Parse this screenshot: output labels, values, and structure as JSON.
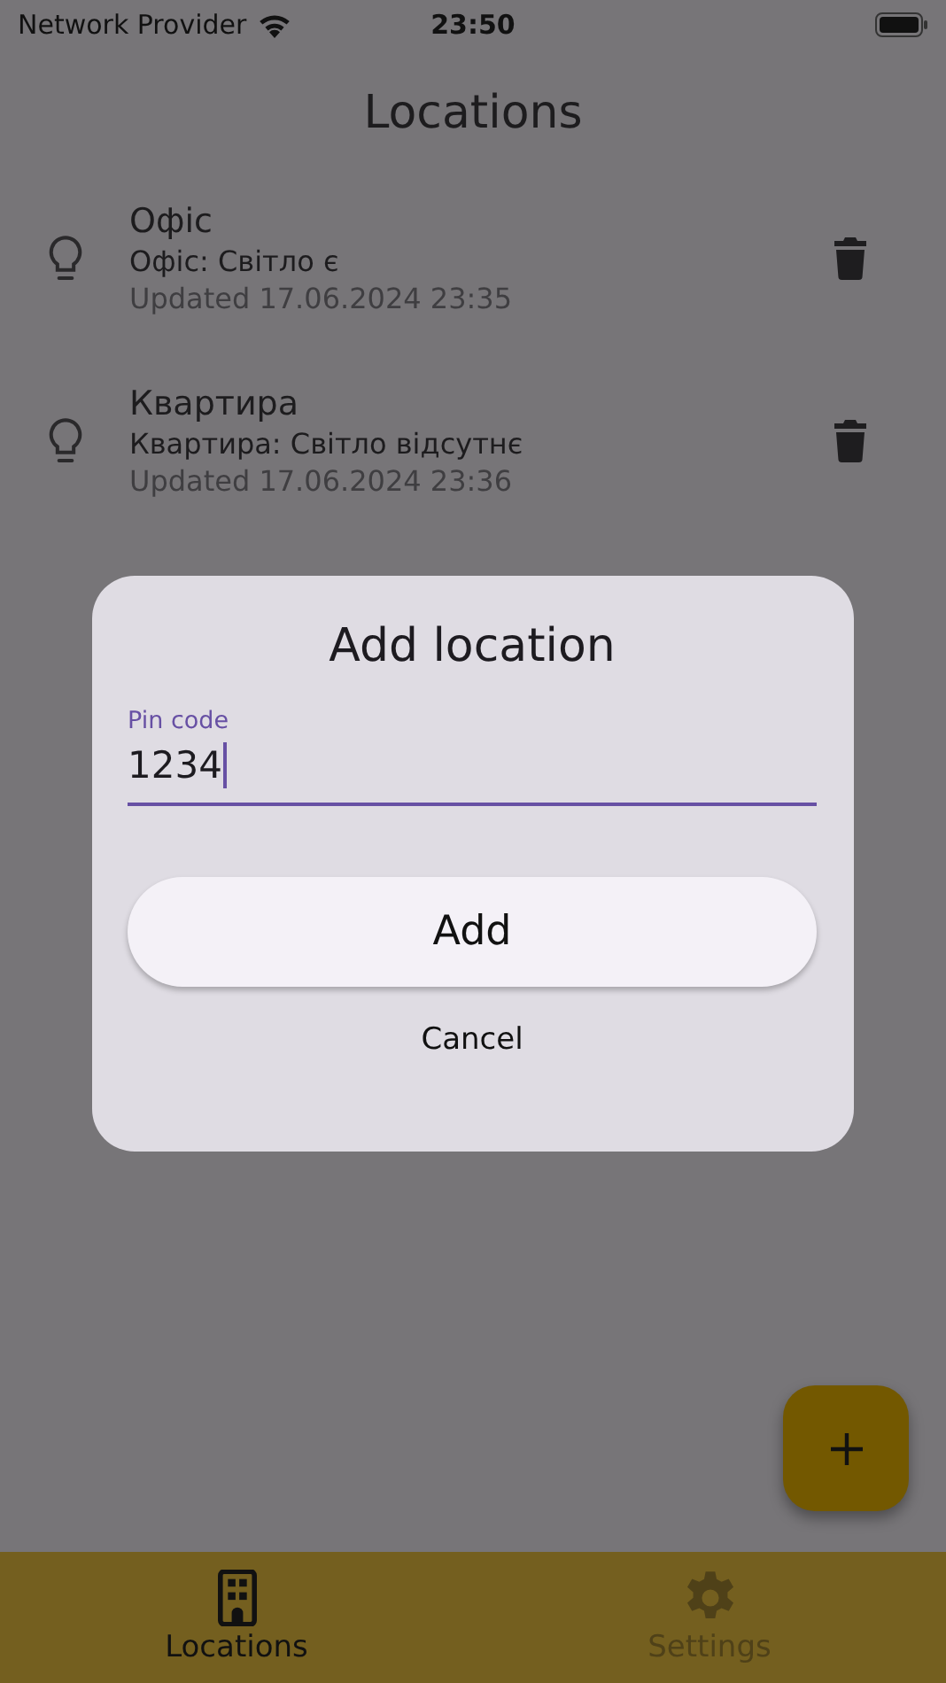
{
  "status_bar": {
    "carrier": "Network Provider",
    "time": "23:50"
  },
  "title": "Locations",
  "locations": [
    {
      "name": "Офіс",
      "status": "Офіс: Світло є",
      "updated": "Updated 17.06.2024 23:35"
    },
    {
      "name": "Квартира",
      "status": "Квартира: Світло відсутнє",
      "updated": "Updated 17.06.2024 23:36"
    }
  ],
  "dialog": {
    "title": "Add location",
    "field": {
      "label": "Pin code",
      "value": "1234",
      "focused": true
    },
    "buttons": [
      {
        "label": "Add",
        "kind": "filled"
      },
      {
        "label": "Cancel",
        "kind": "text"
      }
    ]
  },
  "nav": [
    {
      "label": "Locations",
      "kind": "building",
      "selected": true
    },
    {
      "label": "Settings",
      "kind": "gear",
      "selected": false
    }
  ]
}
